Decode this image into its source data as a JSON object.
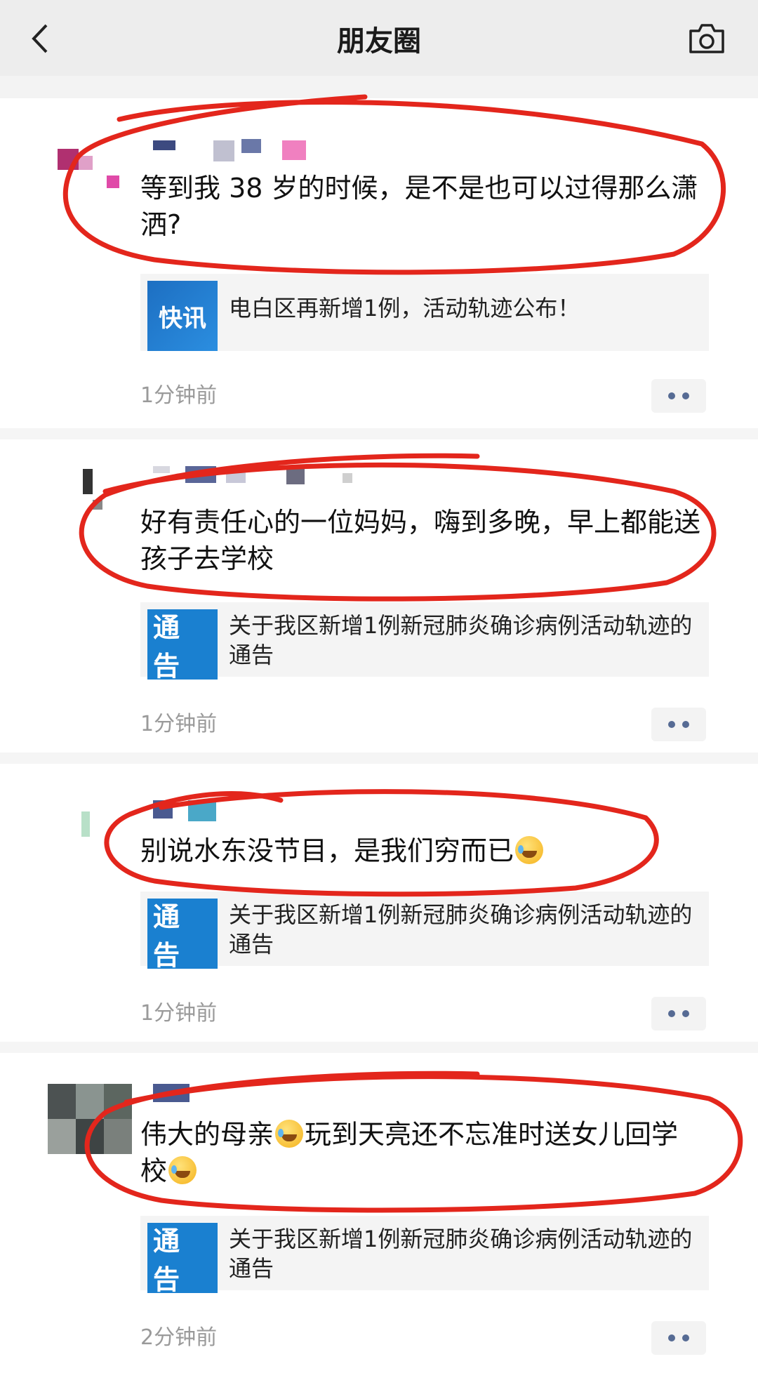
{
  "header": {
    "back_icon": "chevron-left-icon",
    "title": "朋友圈",
    "camera_icon": "camera-icon"
  },
  "colors": {
    "annotation": "#e3261c",
    "link_thumb": "#1a80d0",
    "more_dots": "#566b94"
  },
  "posts": [
    {
      "text": "等到我 38 岁的时候，是不是也可以过得那么潇洒?",
      "link": {
        "thumb_label": "快讯",
        "title": "电白区再新增1例，活动轨迹公布！"
      },
      "time": "1分钟前"
    },
    {
      "text": "好有责任心的一位妈妈，嗨到多晚，早上都能送孩子去学校",
      "link": {
        "thumb_label": "通告",
        "title": "关于我区新增1例新冠肺炎确诊病例活动轨迹的通告"
      },
      "time": "1分钟前"
    },
    {
      "text": "别说水东没节目，是我们穷而已",
      "link": {
        "thumb_label": "通告",
        "title": "关于我区新增1例新冠肺炎确诊病例活动轨迹的通告"
      },
      "time": "1分钟前"
    },
    {
      "text_part1": "伟大的母亲",
      "text_part2": "玩到天亮还不忘准时送女儿回学校",
      "link": {
        "thumb_label": "通告",
        "title": "关于我区新增1例新冠肺炎确诊病例活动轨迹的通告"
      },
      "time": "2分钟前"
    }
  ]
}
